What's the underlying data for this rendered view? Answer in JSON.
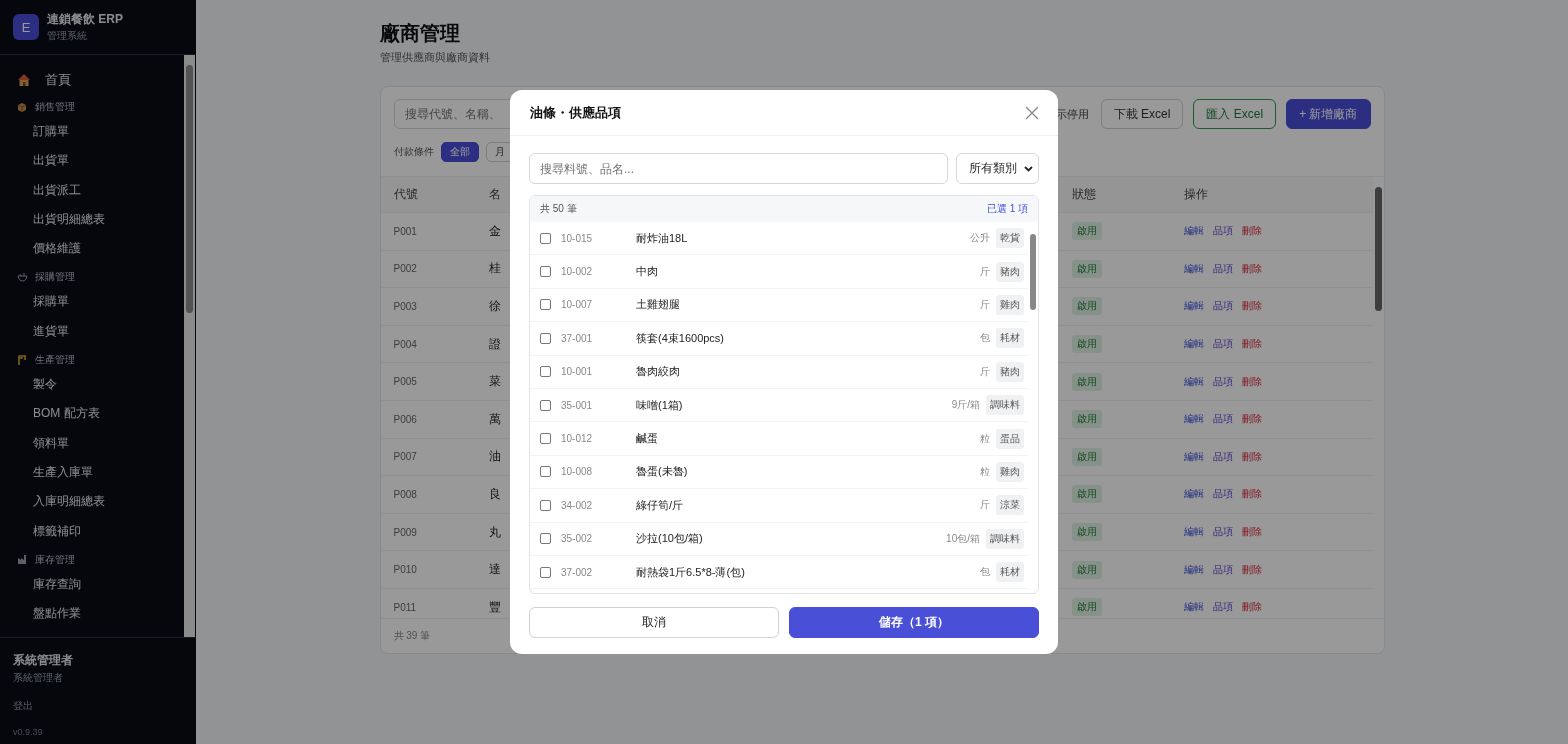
{
  "sidebar": {
    "logo_letter": "E",
    "app_name": "連鎖餐飲 ERP",
    "app_subtitle": "管理系統",
    "nav": [
      {
        "kind": "link",
        "label": "首頁"
      },
      {
        "kind": "group",
        "label": "銷售管理",
        "children": [
          {
            "label": "訂購單"
          },
          {
            "label": "出貨單"
          },
          {
            "label": "出貨派工"
          },
          {
            "label": "出貨明細總表"
          },
          {
            "label": "價格維護"
          }
        ]
      },
      {
        "kind": "group",
        "label": "採購管理",
        "children": [
          {
            "label": "採購單"
          },
          {
            "label": "進貨單"
          }
        ]
      },
      {
        "kind": "group",
        "label": "生產管理",
        "children": [
          {
            "label": "製令"
          },
          {
            "label": "BOM 配方表"
          },
          {
            "label": "領料單"
          },
          {
            "label": "生產入庫單"
          },
          {
            "label": "入庫明細總表"
          },
          {
            "label": "標籤補印"
          }
        ]
      },
      {
        "kind": "group",
        "label": "庫存管理",
        "children": [
          {
            "label": "庫存查詢"
          },
          {
            "label": "盤點作業"
          }
        ]
      }
    ],
    "user_name": "系統管理者",
    "user_role": "系統管理者",
    "logout": "登出",
    "version": "v0.9.39"
  },
  "page": {
    "title": "廠商管理",
    "subtitle": "管理供應商與廠商資料"
  },
  "toolbar": {
    "search_placeholder": "搜尋代號、名稱、",
    "show_disabled_label": "示停用",
    "buttons": [
      {
        "label": "下載 Excel",
        "kind": "outline"
      },
      {
        "label": "匯入 Excel",
        "kind": "success"
      },
      {
        "label": "+ 新增廠商",
        "kind": "primary"
      }
    ]
  },
  "filter": {
    "label": "付款條件",
    "chips": [
      {
        "label": "全部",
        "selected": true
      },
      {
        "label": "月",
        "selected": false
      }
    ]
  },
  "table": {
    "columns": [
      "代號",
      "名",
      "狀態",
      "操作"
    ],
    "rows": [
      {
        "code": "P001",
        "name": "金",
        "status": "啟用",
        "actions": [
          {
            "label": "編輯",
            "kind": "edit"
          },
          {
            "label": "品項",
            "kind": "items"
          },
          {
            "label": "刪除",
            "kind": "delete"
          }
        ]
      },
      {
        "code": "P002",
        "name": "桂",
        "status": "啟用",
        "actions": [
          {
            "label": "編輯",
            "kind": "edit"
          },
          {
            "label": "品項",
            "kind": "items"
          },
          {
            "label": "刪除",
            "kind": "delete"
          }
        ]
      },
      {
        "code": "P003",
        "name": "徐",
        "status": "啟用",
        "actions": [
          {
            "label": "編輯",
            "kind": "edit"
          },
          {
            "label": "品項",
            "kind": "items"
          },
          {
            "label": "刪除",
            "kind": "delete"
          }
        ]
      },
      {
        "code": "P004",
        "name": "證",
        "status": "啟用",
        "actions": [
          {
            "label": "編輯",
            "kind": "edit"
          },
          {
            "label": "品項",
            "kind": "items"
          },
          {
            "label": "刪除",
            "kind": "delete"
          }
        ]
      },
      {
        "code": "P005",
        "name": "菜",
        "status": "啟用",
        "actions": [
          {
            "label": "編輯",
            "kind": "edit"
          },
          {
            "label": "品項",
            "kind": "items"
          },
          {
            "label": "刪除",
            "kind": "delete"
          }
        ]
      },
      {
        "code": "P006",
        "name": "萬",
        "status": "啟用",
        "actions": [
          {
            "label": "編輯",
            "kind": "edit"
          },
          {
            "label": "品項",
            "kind": "items"
          },
          {
            "label": "刪除",
            "kind": "delete"
          }
        ]
      },
      {
        "code": "P007",
        "name": "油",
        "status": "啟用",
        "actions": [
          {
            "label": "編輯",
            "kind": "edit"
          },
          {
            "label": "品項",
            "kind": "items"
          },
          {
            "label": "刪除",
            "kind": "delete"
          }
        ]
      },
      {
        "code": "P008",
        "name": "良",
        "status": "啟用",
        "actions": [
          {
            "label": "編輯",
            "kind": "edit"
          },
          {
            "label": "品項",
            "kind": "items"
          },
          {
            "label": "刪除",
            "kind": "delete"
          }
        ]
      },
      {
        "code": "P009",
        "name": "丸",
        "status": "啟用",
        "actions": [
          {
            "label": "編輯",
            "kind": "edit"
          },
          {
            "label": "品項",
            "kind": "items"
          },
          {
            "label": "刪除",
            "kind": "delete"
          }
        ]
      },
      {
        "code": "P010",
        "name": "達",
        "status": "啟用",
        "actions": [
          {
            "label": "編輯",
            "kind": "edit"
          },
          {
            "label": "品項",
            "kind": "items"
          },
          {
            "label": "刪除",
            "kind": "delete"
          }
        ]
      },
      {
        "code": "P011",
        "name": "豐",
        "status": "啟用",
        "actions": [
          {
            "label": "編輯",
            "kind": "edit"
          },
          {
            "label": "品項",
            "kind": "items"
          },
          {
            "label": "刪除",
            "kind": "delete"
          }
        ]
      }
    ],
    "footer": "共 39 筆"
  },
  "modal": {
    "title": "油條・供應品項",
    "search_placeholder": "搜尋料號、品名...",
    "category_select": "所有類別",
    "total": "共 50 筆",
    "selected_count": "已選 1 項",
    "items": [
      {
        "code": "10-015",
        "name": "耐炸油18L",
        "unit": "公升",
        "category": "乾貨",
        "checked": false
      },
      {
        "code": "10-002",
        "name": "中肉",
        "unit": "斤",
        "category": "豬肉",
        "checked": false
      },
      {
        "code": "10-007",
        "name": "土雞翅腿",
        "unit": "斤",
        "category": "雞肉",
        "checked": false
      },
      {
        "code": "37-001",
        "name": "筷套(4束1600pcs)",
        "unit": "包",
        "category": "耗材",
        "checked": false
      },
      {
        "code": "10-001",
        "name": "魯肉絞肉",
        "unit": "斤",
        "category": "豬肉",
        "checked": false
      },
      {
        "code": "35-001",
        "name": "味噌(1箱)",
        "unit": "9斤/箱",
        "category": "調味料",
        "checked": false
      },
      {
        "code": "10-012",
        "name": "鹹蛋",
        "unit": "粒",
        "category": "蛋品",
        "checked": false
      },
      {
        "code": "10-008",
        "name": "魯蛋(未魯)",
        "unit": "粒",
        "category": "雞肉",
        "checked": false
      },
      {
        "code": "34-002",
        "name": "綠仔筍/斤",
        "unit": "斤",
        "category": "涼菜",
        "checked": false
      },
      {
        "code": "35-002",
        "name": "沙拉(10包/箱)",
        "unit": "10包/箱",
        "category": "調味料",
        "checked": false
      },
      {
        "code": "37-002",
        "name": "耐熱袋1斤6.5*8-薄(包)",
        "unit": "包",
        "category": "耗材",
        "checked": false
      }
    ],
    "cancel": "取消",
    "save": "儲存（1 項）"
  }
}
